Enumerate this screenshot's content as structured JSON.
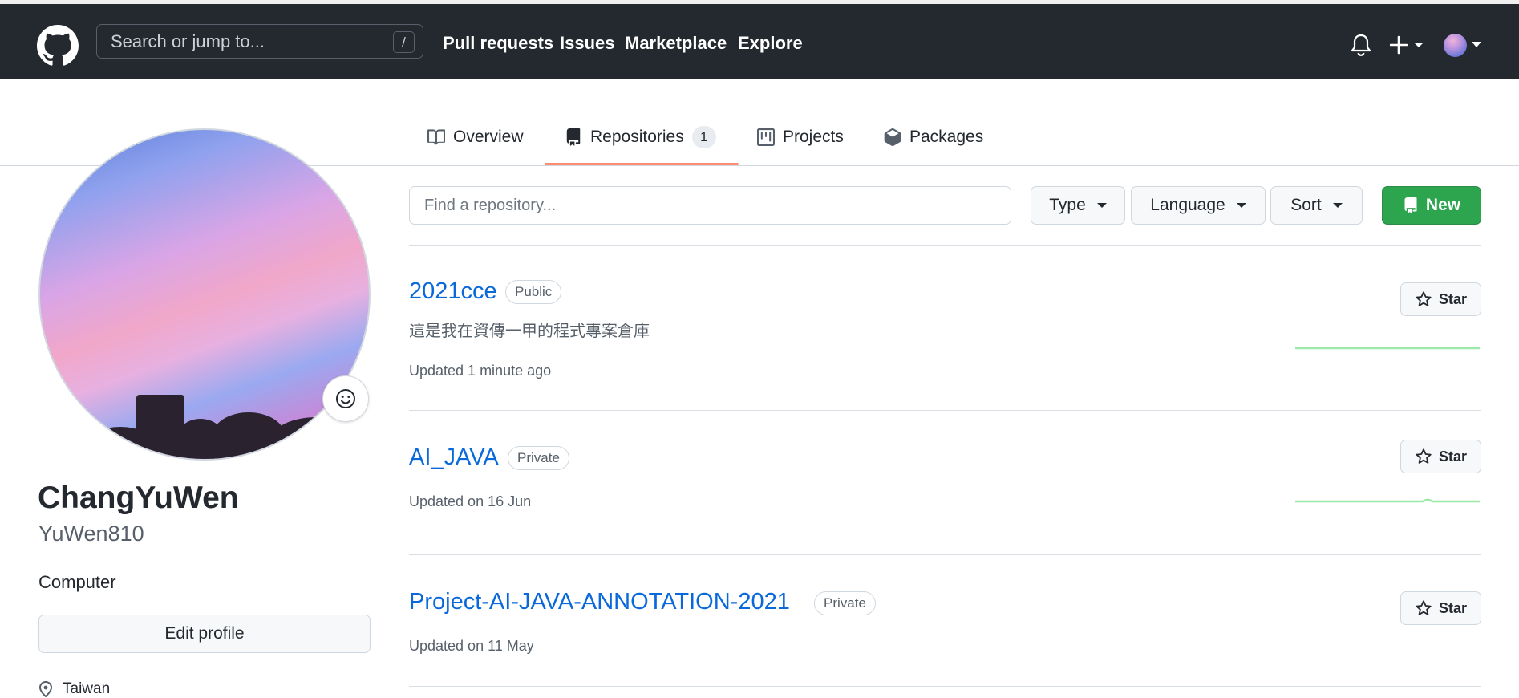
{
  "header": {
    "search_placeholder": "Search or jump to...",
    "search_shortcut": "/",
    "nav": [
      "Pull requests",
      "Issues",
      "Marketplace",
      "Explore"
    ],
    "icons": [
      "github-logo-icon",
      "bell-icon",
      "plus-icon",
      "avatar"
    ]
  },
  "tabs": [
    {
      "label": "Overview",
      "icon": "book-icon"
    },
    {
      "label": "Repositories",
      "icon": "repo-icon",
      "count": "1",
      "selected": true
    },
    {
      "label": "Projects",
      "icon": "project-icon"
    },
    {
      "label": "Packages",
      "icon": "package-icon"
    }
  ],
  "profile": {
    "fullname": "ChangYuWen",
    "login": "YuWen810",
    "bio": "Computer",
    "edit_label": "Edit profile",
    "location": "Taiwan"
  },
  "filters": {
    "find_placeholder": "Find a repository...",
    "type_label": "Type",
    "language_label": "Language",
    "sort_label": "Sort",
    "new_label": "New"
  },
  "repos": [
    {
      "name": "2021cce",
      "visibility": "Public",
      "description": "這是我在資傳一甲的程式專案倉庫",
      "updated": "Updated 1 minute ago",
      "star_label": "Star"
    },
    {
      "name": "AI_JAVA",
      "visibility": "Private",
      "updated": "Updated on 16 Jun",
      "star_label": "Star"
    },
    {
      "name": "Project-AI-JAVA-ANNOTATION-2021",
      "visibility": "Private",
      "updated": "Updated on 11 May",
      "star_label": "Star"
    }
  ],
  "colors": {
    "header_bg": "#24292f",
    "link": "#0969da",
    "new_button": "#2da44e",
    "tab_underline": "#fd8c73",
    "spark": "#9be9a8"
  }
}
